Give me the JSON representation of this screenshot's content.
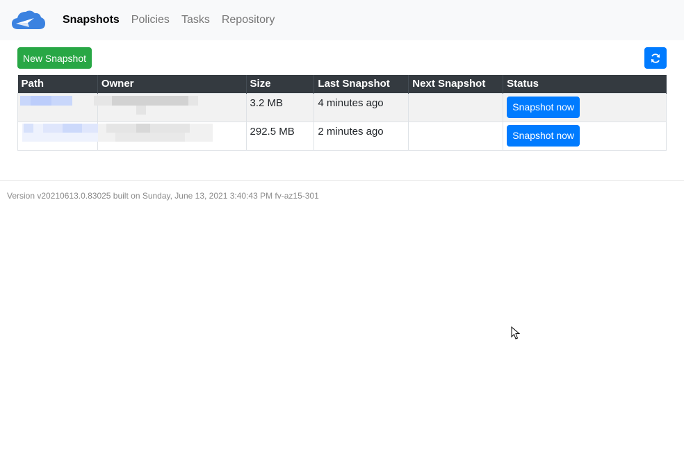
{
  "nav": {
    "items": [
      {
        "label": "Snapshots",
        "active": true
      },
      {
        "label": "Policies",
        "active": false
      },
      {
        "label": "Tasks",
        "active": false
      },
      {
        "label": "Repository",
        "active": false
      }
    ]
  },
  "toolbar": {
    "new_snapshot_label": "New Snapshot",
    "refresh_icon": "refresh-icon"
  },
  "table": {
    "headers": [
      "Path",
      "Owner",
      "Size",
      "Last Snapshot",
      "Next Snapshot",
      "Status"
    ],
    "rows": [
      {
        "path": "",
        "owner": "",
        "size": "3.2 MB",
        "last_snapshot": "4 minutes ago",
        "next_snapshot": "",
        "action_label": "Snapshot now"
      },
      {
        "path": "",
        "owner": "",
        "size": "292.5 MB",
        "last_snapshot": "2 minutes ago",
        "next_snapshot": "",
        "action_label": "Snapshot now"
      }
    ]
  },
  "footer": {
    "version_text": "Version v20210613.0.83025 built on Sunday, June 13, 2021 3:40:43 PM fv-az15-301"
  },
  "colors": {
    "nav_bg": "#f8f9fa",
    "success": "#28a745",
    "primary": "#007bff",
    "header_dark": "#343a40"
  }
}
